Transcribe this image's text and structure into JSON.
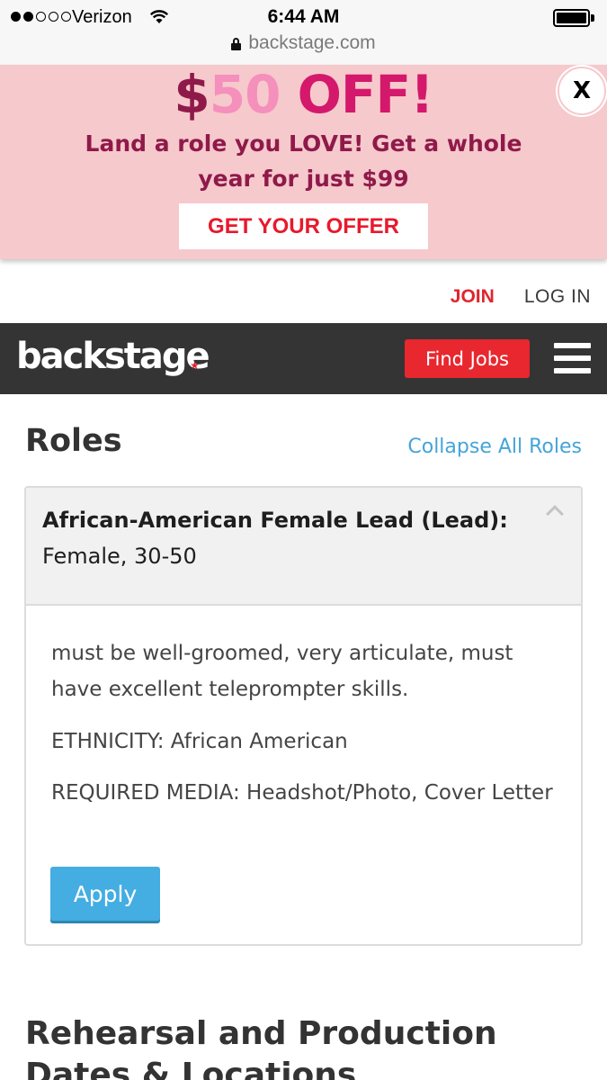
{
  "statusbar": {
    "carrier": "Verizon",
    "time": "6:44 AM",
    "url": "backstage.com"
  },
  "promo": {
    "headline_part1": "$",
    "headline_part2": "50",
    "headline_part3": " OFF!",
    "subtext": "Land a role you LOVE! Get a whole year for just $99",
    "offer_button": "GET YOUR OFFER",
    "close_label": "X",
    "colors": {
      "background": "#f6c9cc",
      "headline_dark": "#8f1a4a",
      "headline_pink": "#f58fbc",
      "headline_magenta": "#d4186b",
      "button_text": "#e8192c"
    }
  },
  "toplinks": {
    "join": "JOIN",
    "login": "LOG IN"
  },
  "navbar": {
    "logo": "backstage",
    "find_jobs": "Find Jobs",
    "menu_icon": "hamburger-menu-icon",
    "colors": {
      "background": "#343434",
      "accent": "#e8272f"
    }
  },
  "roles": {
    "title": "Roles",
    "collapse_link": "Collapse All Roles",
    "items": [
      {
        "name": "African-American Female Lead (Lead):",
        "meta": "Female, 30-50",
        "description": "must be well-groomed, very articulate, must have excellent teleprompter skills.",
        "ethnicity": "ETHNICITY: African American",
        "required_media": "REQUIRED MEDIA: Headshot/Photo, Cover Letter",
        "apply": "Apply"
      }
    ]
  },
  "next_section": {
    "title": "Rehearsal and Production Dates & Locations"
  }
}
